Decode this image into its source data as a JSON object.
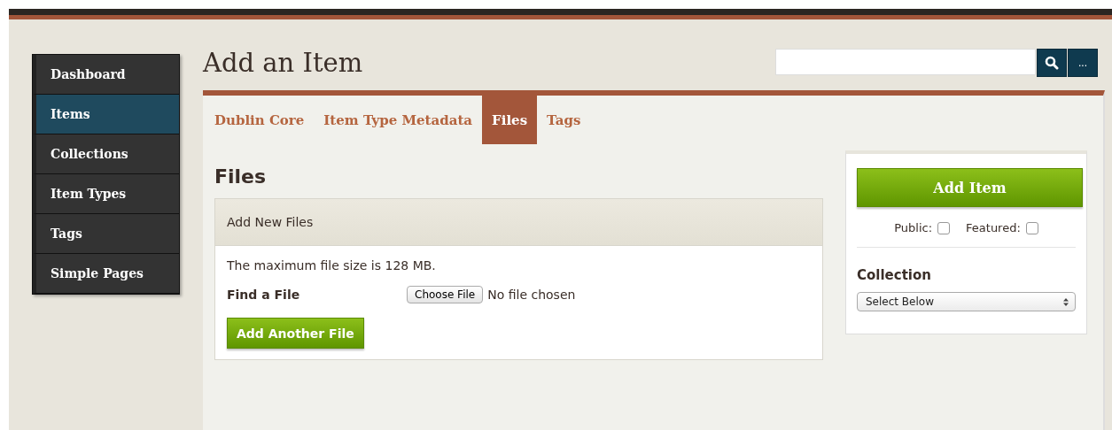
{
  "sidebar": {
    "items": [
      {
        "label": "Dashboard",
        "selected": false
      },
      {
        "label": "Items",
        "selected": true
      },
      {
        "label": "Collections",
        "selected": false
      },
      {
        "label": "Item Types",
        "selected": false
      },
      {
        "label": "Tags",
        "selected": false
      },
      {
        "label": "Simple Pages",
        "selected": false
      }
    ]
  },
  "page_title": "Add an Item",
  "search": {
    "more_label": "..."
  },
  "tabs": [
    {
      "label": "Dublin Core",
      "selected": false
    },
    {
      "label": "Item Type Metadata",
      "selected": false
    },
    {
      "label": "Files",
      "selected": true
    },
    {
      "label": "Tags",
      "selected": false
    }
  ],
  "section_title": "Files",
  "files_panel": {
    "title": "Add New Files",
    "note": "The maximum file size is 128 MB.",
    "field_label": "Find a File",
    "choose_button": "Choose File",
    "file_status": "No file chosen",
    "add_button": "Add Another File"
  },
  "side_panel": {
    "add_button": "Add Item",
    "checkboxes": [
      {
        "label": "Public:",
        "checked": false
      },
      {
        "label": "Featured:",
        "checked": false
      }
    ],
    "collection_label": "Collection",
    "collection_value": "Select Below"
  }
}
